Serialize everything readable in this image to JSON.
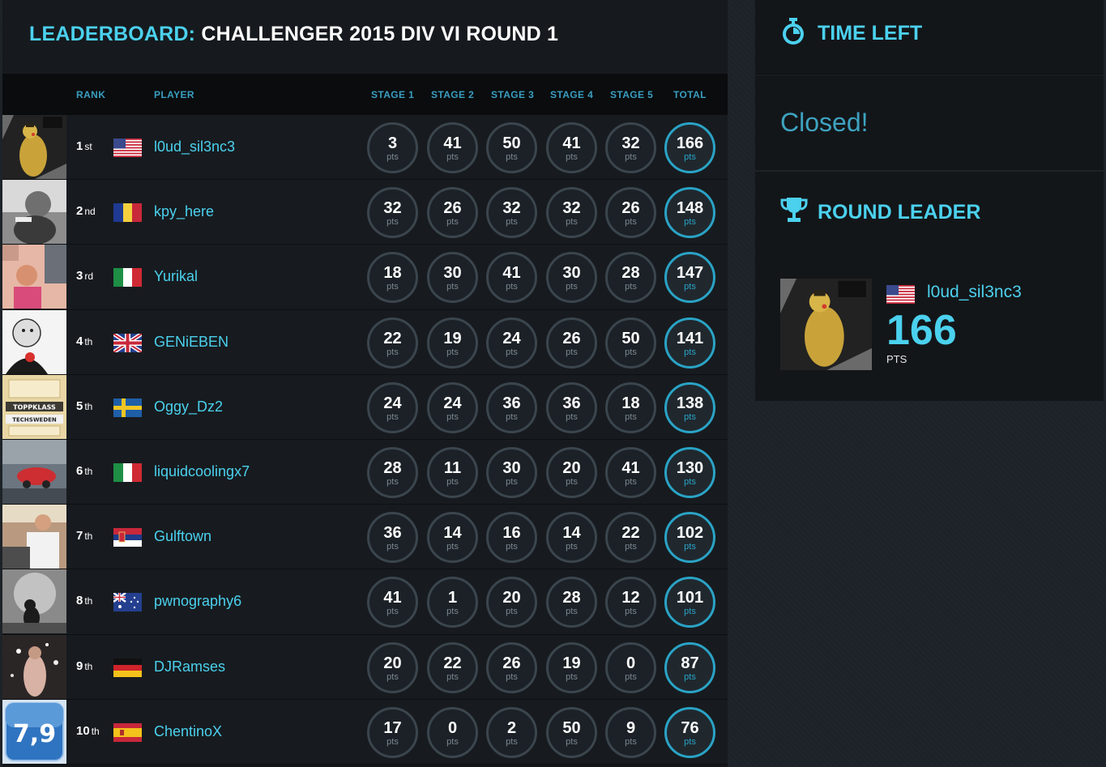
{
  "leaderboard": {
    "title_highlight": "LEADERBOARD:",
    "title_rest": " CHALLENGER 2015 DIV VI ROUND 1",
    "columns": {
      "rank": "RANK",
      "player": "PLAYER",
      "stage1": "STAGE 1",
      "stage2": "STAGE 2",
      "stage3": "STAGE 3",
      "stage4": "STAGE 4",
      "stage5": "STAGE 5",
      "total": "TOTAL"
    },
    "unit": "pts",
    "rows": [
      {
        "rank": "1",
        "suffix": "st",
        "flag": "us-flag",
        "player": "l0ud_sil3nc3",
        "stages": [
          "3",
          "41",
          "50",
          "41",
          "32"
        ],
        "total": "166"
      },
      {
        "rank": "2",
        "suffix": "nd",
        "flag": "ro-flag",
        "player": "kpy_here",
        "stages": [
          "32",
          "26",
          "32",
          "32",
          "26"
        ],
        "total": "148"
      },
      {
        "rank": "3",
        "suffix": "rd",
        "flag": "it-flag",
        "player": "Yurikal",
        "stages": [
          "18",
          "30",
          "41",
          "30",
          "28"
        ],
        "total": "147"
      },
      {
        "rank": "4",
        "suffix": "th",
        "flag": "gb-flag",
        "player": "GENiEBEN",
        "stages": [
          "22",
          "19",
          "24",
          "26",
          "50"
        ],
        "total": "141"
      },
      {
        "rank": "5",
        "suffix": "th",
        "flag": "se-flag",
        "player": "Oggy_Dz2",
        "stages": [
          "24",
          "24",
          "36",
          "36",
          "18"
        ],
        "total": "138"
      },
      {
        "rank": "6",
        "suffix": "th",
        "flag": "it-flag",
        "player": "liquidcoolingx7",
        "stages": [
          "28",
          "11",
          "30",
          "20",
          "41"
        ],
        "total": "130"
      },
      {
        "rank": "7",
        "suffix": "th",
        "flag": "rs-flag",
        "player": "Gulftown",
        "stages": [
          "36",
          "14",
          "16",
          "14",
          "22"
        ],
        "total": "102"
      },
      {
        "rank": "8",
        "suffix": "th",
        "flag": "au-flag",
        "player": "pwnography6",
        "stages": [
          "41",
          "1",
          "20",
          "28",
          "12"
        ],
        "total": "101"
      },
      {
        "rank": "9",
        "suffix": "th",
        "flag": "de-flag",
        "player": "DJRamses",
        "stages": [
          "20",
          "22",
          "26",
          "19",
          "0"
        ],
        "total": "87"
      },
      {
        "rank": "10",
        "suffix": "th",
        "flag": "es-flag",
        "player": "ChentinoX",
        "stages": [
          "17",
          "0",
          "2",
          "50",
          "9"
        ],
        "total": "76"
      }
    ],
    "avatar_texts": {
      "banner_top": "TOPPKLASS",
      "banner_bottom": "TECHSWEDEN",
      "score_badge": "7,9"
    }
  },
  "time_left": {
    "title": "TIME LEFT",
    "icon": "stopwatch-icon",
    "status": "Closed!"
  },
  "round_leader": {
    "title": "ROUND LEADER",
    "icon": "trophy-icon",
    "flag": "us-flag",
    "player": "l0ud_sil3nc3",
    "score": "166",
    "unit": "PTS"
  },
  "colors": {
    "accent": "#4bd1ee",
    "muted_accent": "#3ea3c0",
    "panel": "#131619",
    "ring": "#3b454d",
    "total_ring": "#2aa3c6"
  }
}
